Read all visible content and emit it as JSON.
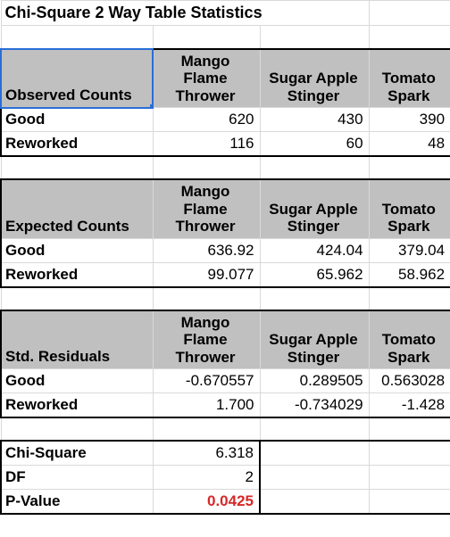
{
  "title": "Chi-Square 2 Way Table Statistics",
  "columns": {
    "c1": "Mango\nFlame\nThrower",
    "c2": "Sugar Apple\nStinger",
    "c3": "Tomato\nSpark"
  },
  "sections": {
    "observed": {
      "label": "Observed Counts",
      "rows": [
        {
          "label": "Good",
          "v": [
            "620",
            "430",
            "390"
          ]
        },
        {
          "label": "Reworked",
          "v": [
            "116",
            "60",
            "48"
          ]
        }
      ]
    },
    "expected": {
      "label": "Expected Counts",
      "rows": [
        {
          "label": "Good",
          "v": [
            "636.92",
            "424.04",
            "379.04"
          ]
        },
        {
          "label": "Reworked",
          "v": [
            "99.077",
            "65.962",
            "58.962"
          ]
        }
      ]
    },
    "residuals": {
      "label": "Std. Residuals",
      "rows": [
        {
          "label": "Good",
          "v": [
            "-0.670557",
            "0.289505",
            "0.563028"
          ]
        },
        {
          "label": "Reworked",
          "v": [
            "1.700",
            "-0.734029",
            "-1.428"
          ]
        }
      ]
    }
  },
  "summary": {
    "chi_label": "Chi-Square",
    "chi_value": "6.318",
    "df_label": "DF",
    "df_value": "2",
    "p_label": "P-Value",
    "p_value": "0.0425"
  },
  "chart_data": {
    "type": "table",
    "title": "Chi-Square 2 Way Table Statistics",
    "columns": [
      "Mango Flame Thrower",
      "Sugar Apple Stinger",
      "Tomato Spark"
    ],
    "observed": {
      "Good": [
        620,
        430,
        390
      ],
      "Reworked": [
        116,
        60,
        48
      ]
    },
    "expected": {
      "Good": [
        636.92,
        424.04,
        379.04
      ],
      "Reworked": [
        99.077,
        65.962,
        58.962
      ]
    },
    "std_residuals": {
      "Good": [
        -0.670557,
        0.289505,
        0.563028
      ],
      "Reworked": [
        1.7,
        -0.734029,
        -1.428
      ]
    },
    "chi_square": 6.318,
    "df": 2,
    "p_value": 0.0425
  }
}
